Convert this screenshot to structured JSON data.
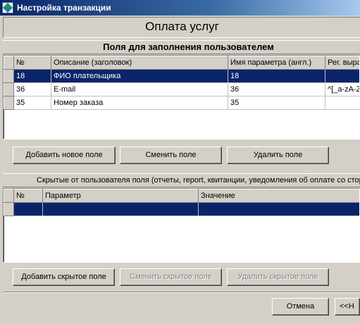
{
  "window": {
    "title": "Настройка транзакции"
  },
  "page": {
    "title": "Оплата услуг"
  },
  "user_fields": {
    "section_title": "Поля для заполнения пользователем",
    "columns": [
      "№",
      "Описание (заголовок)",
      "Имя параметра (англ.)",
      "Рег. выра"
    ],
    "rows": [
      [
        "18",
        "ФИО плательщика",
        "18",
        ""
      ],
      [
        "36",
        "E-mail",
        "36",
        "^[_a-zA-Z\\"
      ],
      [
        "35",
        "Номер заказа",
        "35",
        ""
      ]
    ],
    "selected_row": 0,
    "buttons": {
      "add": "Добавить новое поле",
      "change": "Сменить поле",
      "delete": "Удалить поле"
    }
  },
  "hidden_fields": {
    "section_title": "Скрытые от пользователя поля (отчеты, report, квитанции, уведомления об оплате со стор",
    "columns": [
      "№",
      "Параметр",
      "Значение"
    ],
    "rows": [
      [
        "",
        "",
        ""
      ]
    ],
    "selected_row": 0,
    "buttons": {
      "add": "Добавить скрытое поле",
      "change": "Сменить скрытое поле",
      "delete": "Удалить скрытое поле"
    }
  },
  "footer": {
    "cancel": "Отмена",
    "back": "<<Н"
  },
  "colors": {
    "selection": "#0a246a",
    "face": "#d4d0c8"
  }
}
